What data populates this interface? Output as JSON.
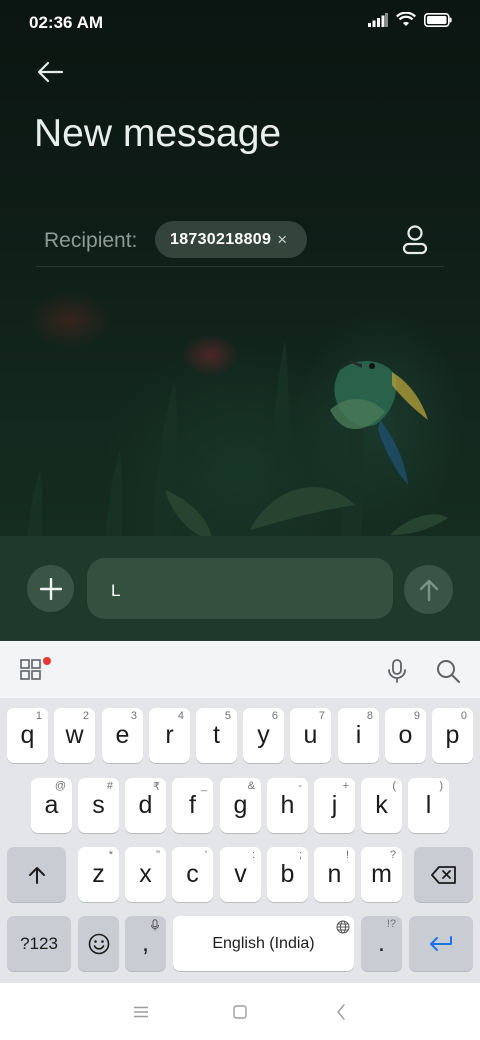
{
  "status_bar": {
    "time": "02:36 AM"
  },
  "header": {
    "title": "New message"
  },
  "recipient": {
    "label": "Recipient:",
    "chip_value": "18730218809",
    "chip_close": "×"
  },
  "compose": {
    "input_value": "L"
  },
  "keyboard": {
    "row1": [
      {
        "label": "q",
        "hint": "1"
      },
      {
        "label": "w",
        "hint": "2"
      },
      {
        "label": "e",
        "hint": "3"
      },
      {
        "label": "r",
        "hint": "4"
      },
      {
        "label": "t",
        "hint": "5"
      },
      {
        "label": "y",
        "hint": "6"
      },
      {
        "label": "u",
        "hint": "7"
      },
      {
        "label": "i",
        "hint": "8"
      },
      {
        "label": "o",
        "hint": "9"
      },
      {
        "label": "p",
        "hint": "0"
      }
    ],
    "row2": [
      {
        "label": "a",
        "hint": "@"
      },
      {
        "label": "s",
        "hint": "#"
      },
      {
        "label": "d",
        "hint": "₹"
      },
      {
        "label": "f",
        "hint": "_"
      },
      {
        "label": "g",
        "hint": "&"
      },
      {
        "label": "h",
        "hint": "-"
      },
      {
        "label": "j",
        "hint": "+"
      },
      {
        "label": "k",
        "hint": "("
      },
      {
        "label": "l",
        "hint": ")"
      }
    ],
    "row3": [
      {
        "label": "z",
        "hint": "*"
      },
      {
        "label": "x",
        "hint": "\""
      },
      {
        "label": "c",
        "hint": "'"
      },
      {
        "label": "v",
        "hint": ":"
      },
      {
        "label": "b",
        "hint": ";"
      },
      {
        "label": "n",
        "hint": "!"
      },
      {
        "label": "m",
        "hint": "?"
      }
    ],
    "symbols_key": "?123",
    "comma_key": ",",
    "space_key": "English (India)",
    "period_key": ".",
    "period_hint": "!?"
  },
  "colors": {
    "accent": "#1a73e8",
    "compose_bg": "#1f3a2a",
    "notification_dot": "#e53935"
  },
  "icons": [
    "back-arrow-icon",
    "contact-icon",
    "plus-icon",
    "send-arrow-icon",
    "apps-grid-icon",
    "mic-icon",
    "search-icon",
    "shift-icon",
    "backspace-icon",
    "emoji-icon",
    "globe-icon",
    "enter-icon",
    "menu-icon",
    "home-icon",
    "back-icon"
  ]
}
